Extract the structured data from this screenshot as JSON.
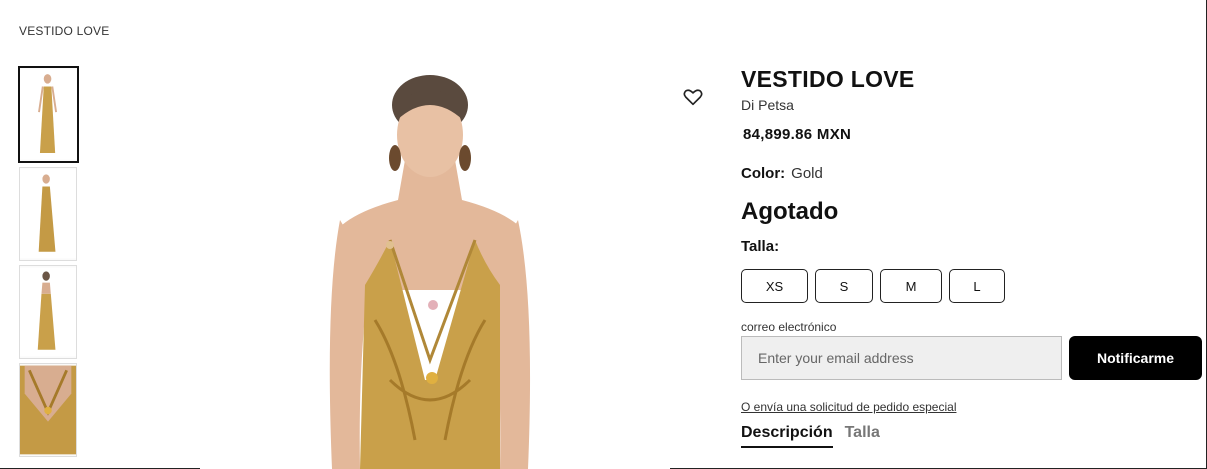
{
  "breadcrumb": "VESTIDO LOVE",
  "product": {
    "title": "VESTIDO LOVE",
    "brand": "Di Petsa",
    "price": "84,899.86 MXN",
    "color_label": "Color:",
    "color_value": "Gold",
    "stock_status": "Agotado",
    "size_label": "Talla:",
    "sizes": [
      "XS",
      "S",
      "M",
      "L"
    ]
  },
  "notify": {
    "email_label": "correo electrónico",
    "email_placeholder": "Enter your email address",
    "button_label": "Notificarme"
  },
  "special_order_link": "O envía una solicitud de pedido especial",
  "tabs": [
    {
      "label": "Descripción",
      "active": true
    },
    {
      "label": "Talla",
      "active": false
    }
  ],
  "colors": {
    "gold": "#c9a04a",
    "skin": "#e3b89a",
    "hair": "#5a4a3e",
    "accent": "#000000"
  }
}
